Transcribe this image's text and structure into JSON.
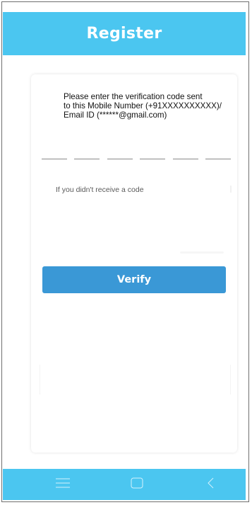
{
  "header": {
    "title": "Register"
  },
  "verification": {
    "message_line1": "Please enter the verification code sent",
    "message_line2": "to this Mobile Number (+91XXXXXXXXXX)/",
    "message_line3": "Email ID (******@gmail.com)",
    "code_length": 6,
    "resend_prompt": "If you didn't receive a code",
    "verify_label": "Verify"
  },
  "navbar": {
    "icons": [
      "menu-icon",
      "home-icon",
      "back-icon"
    ]
  },
  "colors": {
    "header_bg": "#4bc6f0",
    "button_bg": "#3a98d6",
    "navbar_bg": "#4bc6f0"
  }
}
